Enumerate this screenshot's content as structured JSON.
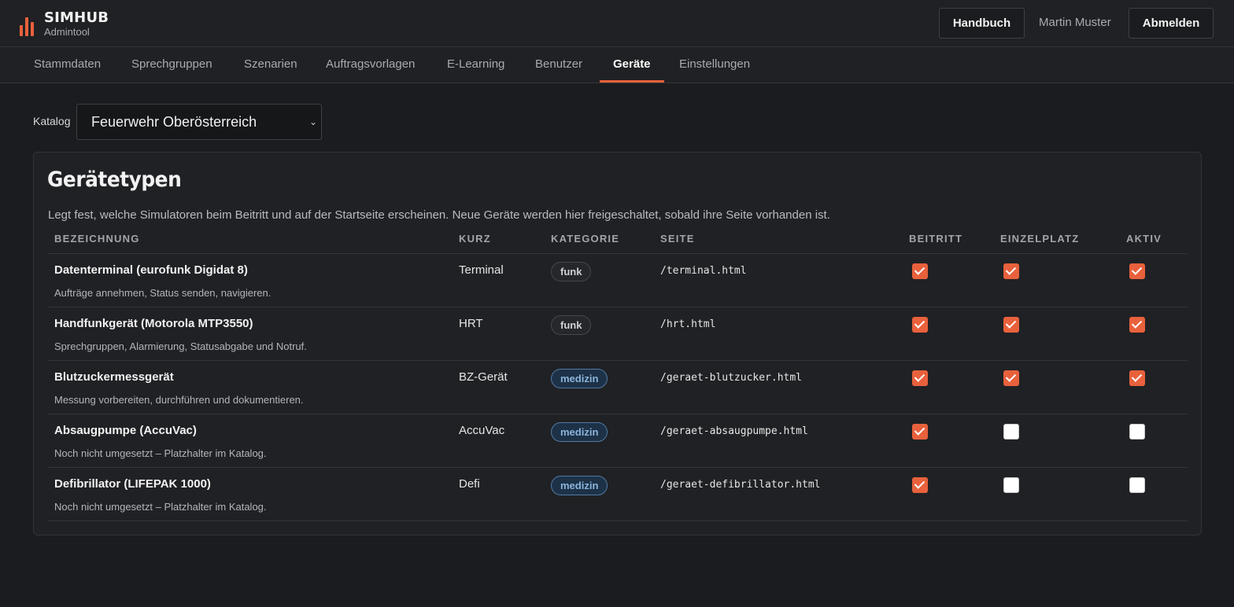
{
  "app": {
    "name": "SIMHUB",
    "subtitle": "Admintool",
    "logo_icon": "bar-chart-icon",
    "accent": "#e8613c"
  },
  "header": {
    "handbuch_label": "Handbuch",
    "user_name": "Martin Muster",
    "logout_label": "Abmelden"
  },
  "nav": {
    "items": [
      {
        "label": "Stammdaten"
      },
      {
        "label": "Sprechgruppen"
      },
      {
        "label": "Szenarien"
      },
      {
        "label": "Auftragsvorlagen"
      },
      {
        "label": "E-Learning"
      },
      {
        "label": "Benutzer"
      },
      {
        "label": "Geräte",
        "active": true
      },
      {
        "label": "Einstellungen"
      }
    ]
  },
  "catalog": {
    "label": "Katalog",
    "selected": "Feuerwehr Oberösterreich"
  },
  "panel": {
    "title": "Gerätetypen",
    "description": "Legt fest, welche Simulatoren beim Beitritt und auf der Startseite erscheinen. Neue Geräte werden hier freigeschaltet, sobald ihre Seite vorhanden ist."
  },
  "table": {
    "headers": {
      "bezeichnung": "BEZEICHNUNG",
      "kurz": "KURZ",
      "kategorie": "KATEGORIE",
      "seite": "SEITE",
      "beitritt": "BEITRITT",
      "einzelplatz": "EINZELPLATZ",
      "aktiv": "AKTIV"
    },
    "rows": [
      {
        "name": "Datenterminal (eurofunk Digidat 8)",
        "desc": "Aufträge annehmen, Status senden, navigieren.",
        "kurz": "Terminal",
        "kategorie": "funk",
        "seite": "/terminal.html",
        "beitritt": true,
        "einzelplatz": true,
        "aktiv": true
      },
      {
        "name": "Handfunkgerät (Motorola MTP3550)",
        "desc": "Sprechgruppen, Alarmierung, Statusabgabe und Notruf.",
        "kurz": "HRT",
        "kategorie": "funk",
        "seite": "/hrt.html",
        "beitritt": true,
        "einzelplatz": true,
        "aktiv": true
      },
      {
        "name": "Blutzuckermessgerät",
        "desc": "Messung vorbereiten, durchführen und dokumentieren.",
        "kurz": "BZ-Gerät",
        "kategorie": "medizin",
        "seite": "/geraet-blutzucker.html",
        "beitritt": true,
        "einzelplatz": true,
        "aktiv": true
      },
      {
        "name": "Absaugpumpe (AccuVac)",
        "desc": "Noch nicht umgesetzt – Platzhalter im Katalog.",
        "kurz": "AccuVac",
        "kategorie": "medizin",
        "seite": "/geraet-absaugpumpe.html",
        "beitritt": true,
        "einzelplatz": false,
        "aktiv": false
      },
      {
        "name": "Defibrillator (LIFEPAK 1000)",
        "desc": "Noch nicht umgesetzt – Platzhalter im Katalog.",
        "kurz": "Defi",
        "kategorie": "medizin",
        "seite": "/geraet-defibrillator.html",
        "beitritt": true,
        "einzelplatz": false,
        "aktiv": false
      }
    ]
  }
}
